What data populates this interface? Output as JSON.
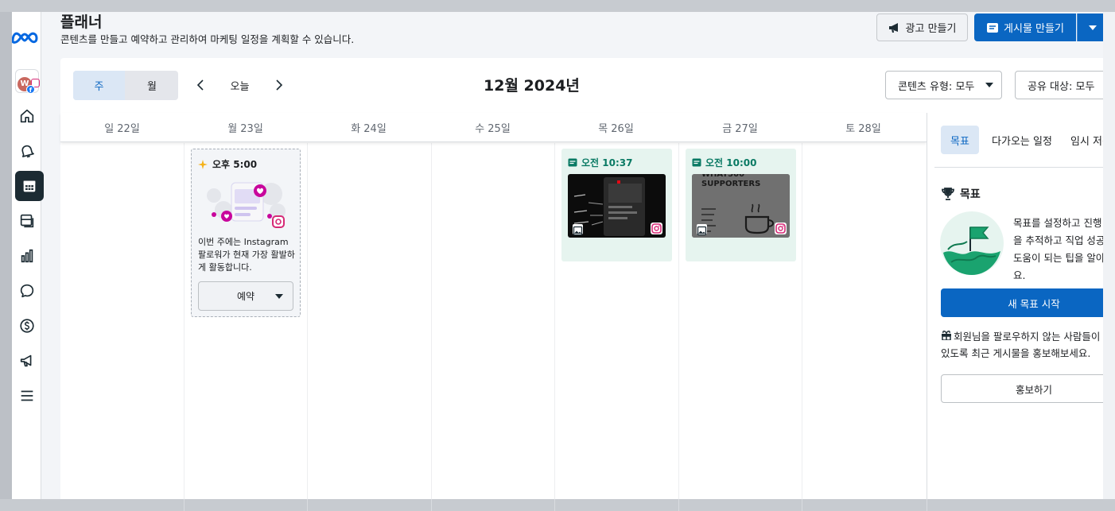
{
  "header": {
    "title": "플래너",
    "subtitle": "콘텐츠를 만들고 예약하고 관리하여 마케팅 일정을 계획할 수 있습니다.",
    "create_ad_label": "광고 만들기",
    "create_post_label": "게시물 만들기"
  },
  "account": {
    "initial": "W"
  },
  "rail": {
    "items": [
      "home-icon",
      "notifications-icon",
      "calendar-icon",
      "content-icon",
      "insights-icon",
      "inbox-icon",
      "monetization-icon",
      "ads-icon",
      "menu-icon"
    ],
    "active": "calendar-icon"
  },
  "calendar": {
    "view_week": "주",
    "view_month": "월",
    "today_label": "오늘",
    "month_label": "12월 2024년",
    "filter_content": "콘텐츠 유형: 모두",
    "filter_shared": "공유 대상: 모두",
    "days": [
      "일 22일",
      "월 23일",
      "화 24일",
      "수 25일",
      "목 26일",
      "금 27일",
      "토 28일"
    ]
  },
  "suggestion": {
    "time": "오후 5:00",
    "text": "이번 주에는 Instagram 팔로워가 현재 가장 활발하게 활동합니다.",
    "schedule_label": "예약"
  },
  "posts": [
    {
      "day": "목 26일",
      "time": "오전 10:37",
      "platform": "instagram",
      "media": "photo"
    },
    {
      "day": "금 27일",
      "time": "오전 10:00",
      "platform": "instagram",
      "media": "photo",
      "thumb_text": "WHAT500 SUPPORTERS"
    }
  ],
  "panel": {
    "tabs": [
      "목표",
      "다가오는 일정",
      "임시 저장"
    ],
    "active_tab": "목표",
    "goals_heading": "목표",
    "goals_desc": "목표를 설정하고 진행 상황을 추적하고 직업 성공에 도움이 되는 팁을 알아보세요.",
    "new_goal_label": "새 목표 시작",
    "promo_text": "회원님을 팔로우하지 않는 사람들이 볼 수 있도록 최근 게시물을 홍보해보세요.",
    "promote_label": "홍보하기"
  },
  "colors": {
    "primary": "#0a66c2",
    "post_bg": "#e6f4ef",
    "post_time": "#0a7a64",
    "rail_active": "#1c2b33"
  }
}
